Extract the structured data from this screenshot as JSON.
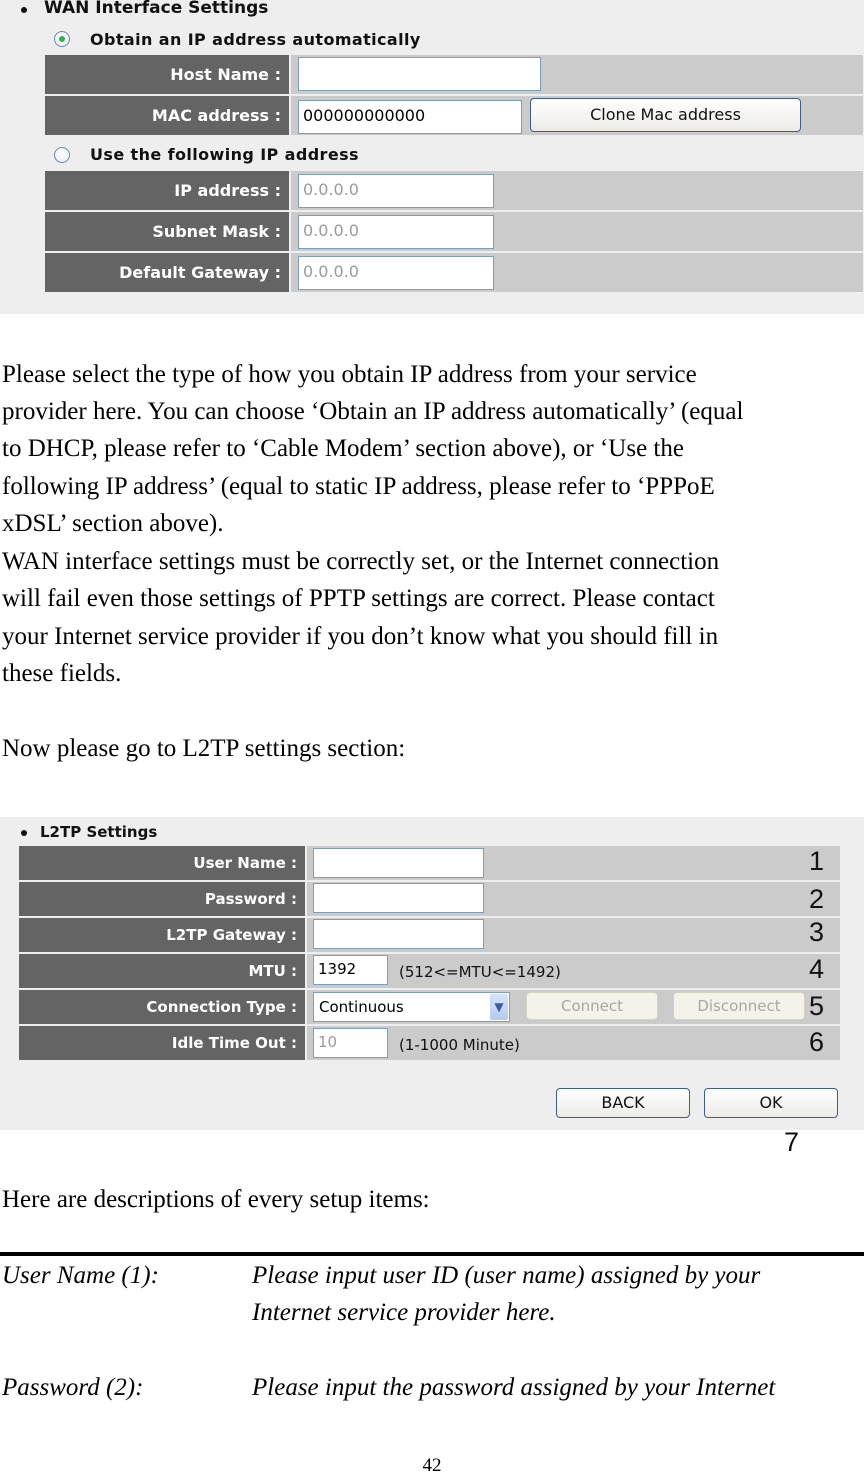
{
  "wan": {
    "title": "WAN Interface Settings",
    "option_auto": {
      "label": "Obtain an IP address automatically",
      "selected": true
    },
    "host_name": {
      "label": "Host Name :",
      "value": ""
    },
    "mac_address": {
      "label": "MAC address :",
      "value": "000000000000"
    },
    "clone_button": "Clone Mac address",
    "option_static": {
      "label": "Use the following IP address",
      "selected": false
    },
    "ip_address": {
      "label": "IP address :",
      "value": "0.0.0.0"
    },
    "subnet_mask": {
      "label": "Subnet Mask :",
      "value": "0.0.0.0"
    },
    "default_gateway": {
      "label": "Default Gateway :",
      "value": "0.0.0.0"
    }
  },
  "text": {
    "para1": [
      "Please select the type of how you obtain IP address from your service",
      "provider here. You can choose ‘Obtain an IP address automatically’ (equal",
      "to DHCP, please refer to ‘Cable Modem’ section above), or ‘Use the",
      "following IP address’ (equal to static IP address, please refer to ‘PPPoE",
      "xDSL’ section above).",
      "WAN interface settings must be correctly set, or the Internet connection",
      "will fail even those settings of PPTP settings are correct. Please contact",
      "your Internet service provider if you don’t know what you should fill in",
      "these fields."
    ],
    "para2": "Now please go to L2TP settings section:",
    "para3": "Here are descriptions of every setup items:"
  },
  "l2tp": {
    "title": "L2TP Settings",
    "user_name": {
      "label": "User Name :",
      "value": "",
      "callout": "1"
    },
    "password": {
      "label": "Password :",
      "value": "",
      "callout": "2"
    },
    "gateway": {
      "label": "L2TP Gateway :",
      "value": "",
      "callout": "3"
    },
    "mtu": {
      "label": "MTU :",
      "value": "1392",
      "hint": "(512<=MTU<=1492)",
      "callout": "4"
    },
    "connection_type": {
      "label": "Connection Type :",
      "value": "Continuous",
      "connect": "Connect",
      "disconnect": "Disconnect",
      "callout": "5"
    },
    "idle_timeout": {
      "label": "Idle Time Out :",
      "value": "10",
      "hint": "(1-1000 Minute)",
      "callout": "6"
    },
    "back_button": "BACK",
    "ok_button": "OK",
    "buttons_callout": "7"
  },
  "descriptions": [
    {
      "term": "User Name (1):",
      "lines": [
        "Please input user ID (user name) assigned by your",
        "Internet service provider here."
      ]
    },
    {
      "term": "Password (2):",
      "lines": [
        "Please input the password assigned by your Internet"
      ]
    }
  ],
  "page_number": "42"
}
